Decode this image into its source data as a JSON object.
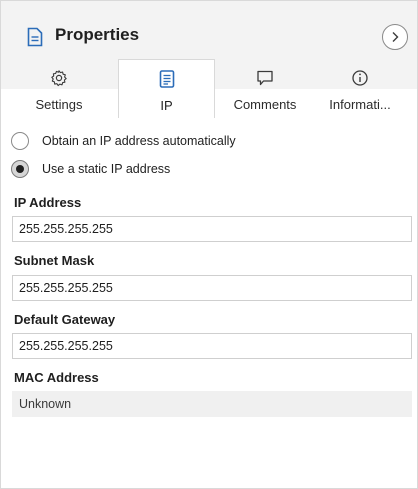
{
  "panel": {
    "title": "Properties",
    "title_icon": "document-icon",
    "collapse_icon": "chevron-right-icon"
  },
  "tabs": [
    {
      "label": "Settings",
      "icon": "gear-icon",
      "active": false
    },
    {
      "label": "IP",
      "icon": "list-document-icon",
      "active": true
    },
    {
      "label": "Comments",
      "icon": "comment-icon",
      "active": false
    },
    {
      "label": "Informati...",
      "icon": "info-icon",
      "active": false
    }
  ],
  "ip": {
    "options": [
      {
        "label": "Obtain an IP address automatically",
        "selected": false
      },
      {
        "label": "Use a static IP address",
        "selected": true
      }
    ],
    "fields": [
      {
        "label": "IP Address",
        "value": "255.255.255.255",
        "readonly": false
      },
      {
        "label": "Subnet Mask",
        "value": "255.255.255.255",
        "readonly": false
      },
      {
        "label": "Default Gateway",
        "value": "255.255.255.255",
        "readonly": false
      },
      {
        "label": "MAC Address",
        "value": "Unknown",
        "readonly": true
      }
    ]
  }
}
